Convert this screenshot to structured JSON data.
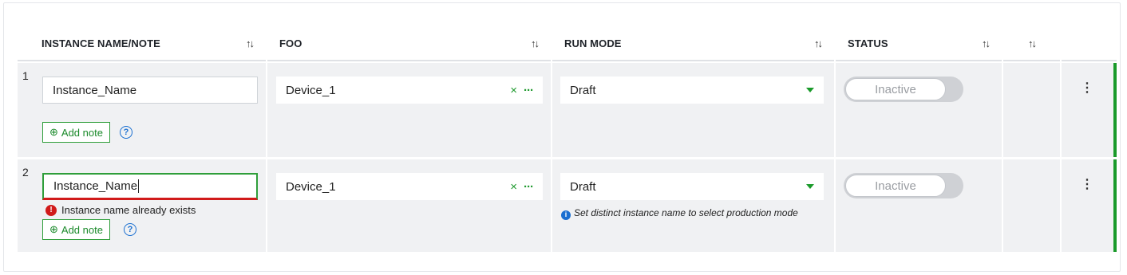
{
  "columns": [
    {
      "label": "INSTANCE NAME/NOTE",
      "sort_icon": "↑↓"
    },
    {
      "label": "FOO",
      "sort_icon": "↑↓"
    },
    {
      "label": "RUN MODE",
      "sort_icon": "↑↓"
    },
    {
      "label": "STATUS",
      "sort_icon": "↑↓"
    },
    {
      "label": "",
      "sort_icon": "↑↓"
    }
  ],
  "rows": [
    {
      "number": "1",
      "instance_name": "Instance_Name",
      "add_note_label": "Add note",
      "device": "Device_1",
      "run_mode": "Draft",
      "status": "Inactive"
    },
    {
      "number": "2",
      "instance_name": "Instance_Name",
      "error_text": "Instance name already exists",
      "add_note_label": "Add note",
      "device": "Device_1",
      "run_mode": "Draft",
      "run_mode_info": "Set distinct instance name to select production mode",
      "status": "Inactive"
    }
  ],
  "icons": {
    "add": "⊕",
    "help": "?",
    "clear": "×",
    "more_horizontal": "···",
    "more_vertical": "⋮",
    "error": "!",
    "info": "i"
  },
  "colors": {
    "accent_green": "#1a9a2a",
    "error_red": "#d11a1a",
    "info_blue": "#1a6fd1",
    "row_bg": "#f0f1f3"
  }
}
